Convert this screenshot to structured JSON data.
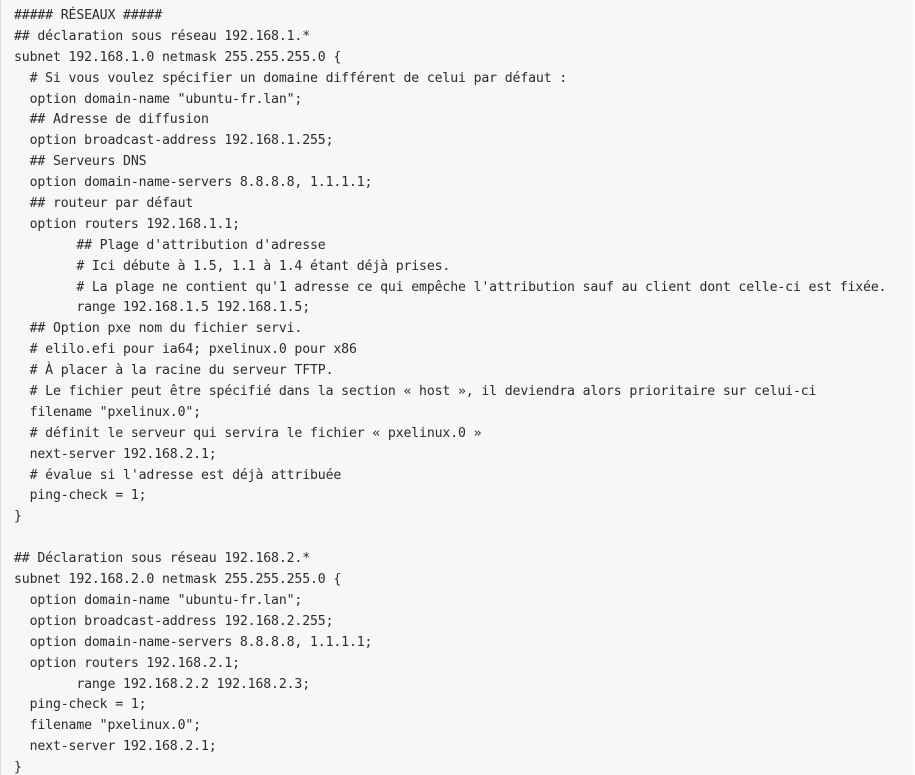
{
  "code_block": {
    "lines": [
      "##### RÉSEAUX #####",
      "## déclaration sous réseau 192.168.1.*",
      "subnet 192.168.1.0 netmask 255.255.255.0 {",
      "  # Si vous voulez spécifier un domaine différent de celui par défaut :",
      "  option domain-name \"ubuntu-fr.lan\";",
      "  ## Adresse de diffusion",
      "  option broadcast-address 192.168.1.255;",
      "  ## Serveurs DNS",
      "  option domain-name-servers 8.8.8.8, 1.1.1.1;",
      "  ## routeur par défaut",
      "  option routers 192.168.1.1;",
      "        ## Plage d'attribution d'adresse",
      "        # Ici débute à 1.5, 1.1 à 1.4 étant déjà prises.",
      "        # La plage ne contient qu'1 adresse ce qui empêche l'attribution sauf au client dont celle-ci est fixée.",
      "        range 192.168.1.5 192.168.1.5;",
      "  ## Option pxe nom du fichier servi.",
      "  # elilo.efi pour ia64; pxelinux.0 pour x86",
      "  # À placer à la racine du serveur TFTP.",
      "  # Le fichier peut être spécifié dans la section « host », il deviendra alors prioritaire sur celui-ci",
      "  filename \"pxelinux.0\";",
      "  # définit le serveur qui servira le fichier « pxelinux.0 »",
      "  next-server 192.168.2.1;",
      "  # évalue si l'adresse est déjà attribuée",
      "  ping-check = 1;",
      "}",
      "",
      "## Déclaration sous réseau 192.168.2.*",
      "subnet 192.168.2.0 netmask 255.255.255.0 {",
      "  option domain-name \"ubuntu-fr.lan\";",
      "  option broadcast-address 192.168.2.255;",
      "  option domain-name-servers 8.8.8.8, 1.1.1.1;",
      "  option routers 192.168.2.1;",
      "        range 192.168.2.2 192.168.2.3;",
      "  ping-check = 1;",
      "  filename \"pxelinux.0\";",
      "  next-server 192.168.2.1;",
      "}"
    ]
  }
}
